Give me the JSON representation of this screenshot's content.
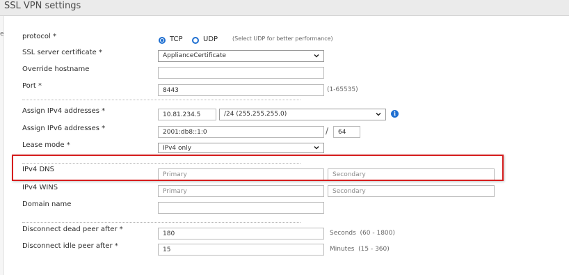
{
  "header": {
    "title": "SSL VPN settings"
  },
  "form": {
    "protocol": {
      "label": "protocol *",
      "options": [
        {
          "label": "TCP",
          "selected": true
        },
        {
          "label": "UDP",
          "selected": false
        }
      ],
      "hint": "(Select UDP for better performance)"
    },
    "ssl_cert": {
      "label": "SSL server certificate *",
      "value": "ApplianceCertificate"
    },
    "override_hostname": {
      "label": "Override hostname",
      "value": ""
    },
    "port": {
      "label": "Port *",
      "value": "8443",
      "hint": "(1-65535)"
    },
    "ipv4_addr": {
      "label": "Assign IPv4 addresses *",
      "value": "10.81.234.5",
      "mask": "/24 (255.255.255.0)"
    },
    "ipv6_addr": {
      "label": "Assign IPv6 addresses *",
      "value": "2001:db8::1:0",
      "separator": "/",
      "prefix": "64"
    },
    "lease_mode": {
      "label": "Lease mode *",
      "value": "IPv4 only"
    },
    "ipv4_dns": {
      "label": "IPv4 DNS",
      "primary_placeholder": "Primary",
      "secondary_placeholder": "Secondary"
    },
    "ipv4_wins": {
      "label": "IPv4 WINS",
      "primary_placeholder": "Primary",
      "secondary_placeholder": "Secondary"
    },
    "domain_name": {
      "label": "Domain name",
      "value": ""
    },
    "dead_peer": {
      "label": "Disconnect dead peer after *",
      "value": "180",
      "hint": "Seconds  (60 - 1800)"
    },
    "idle_peer": {
      "label": "Disconnect idle peer after *",
      "value": "15",
      "hint": "Minutes  (15 - 360)"
    }
  },
  "colors": {
    "accent": "#1f6fd1",
    "highlight": "#d61d1d",
    "header_bg": "#ebebeb"
  },
  "icons": {
    "info": "info-icon",
    "dropdown": "chevron-down-icon"
  }
}
